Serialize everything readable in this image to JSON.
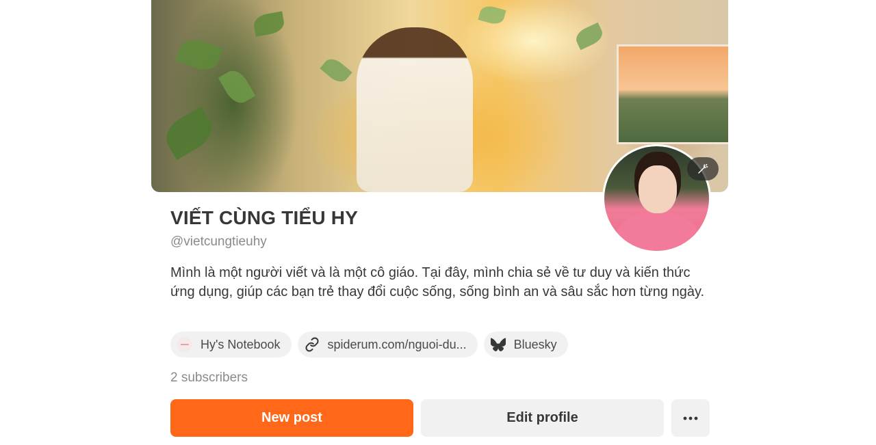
{
  "profile": {
    "name": "VIẾT CÙNG TIỂU HY",
    "handle": "@vietcungtieuhy",
    "bio": "Mình là một người viết và là một cô giáo. Tại đây, mình chia sẻ về tư duy và kiến thức ứng dụng, giúp các bạn trẻ thay đổi cuộc sống, sống bình an và sâu sắc hơn từng ngày.",
    "subscribers": "2 subscribers"
  },
  "links": [
    {
      "label": "Hy's Notebook",
      "icon": "notebook-favicon"
    },
    {
      "label": "spiderum.com/nguoi-du...",
      "icon": "link-icon"
    },
    {
      "label": "Bluesky",
      "icon": "butterfly-icon"
    }
  ],
  "actions": {
    "new_post": "New post",
    "edit_profile": "Edit profile",
    "more": "more-horizontal-icon"
  },
  "cover": {
    "edit_icon": "magic-wand-icon"
  },
  "colors": {
    "accent": "#ff6719",
    "text": "#363737",
    "muted": "#8a8a8a",
    "chip_bg": "#f1f1f1"
  }
}
